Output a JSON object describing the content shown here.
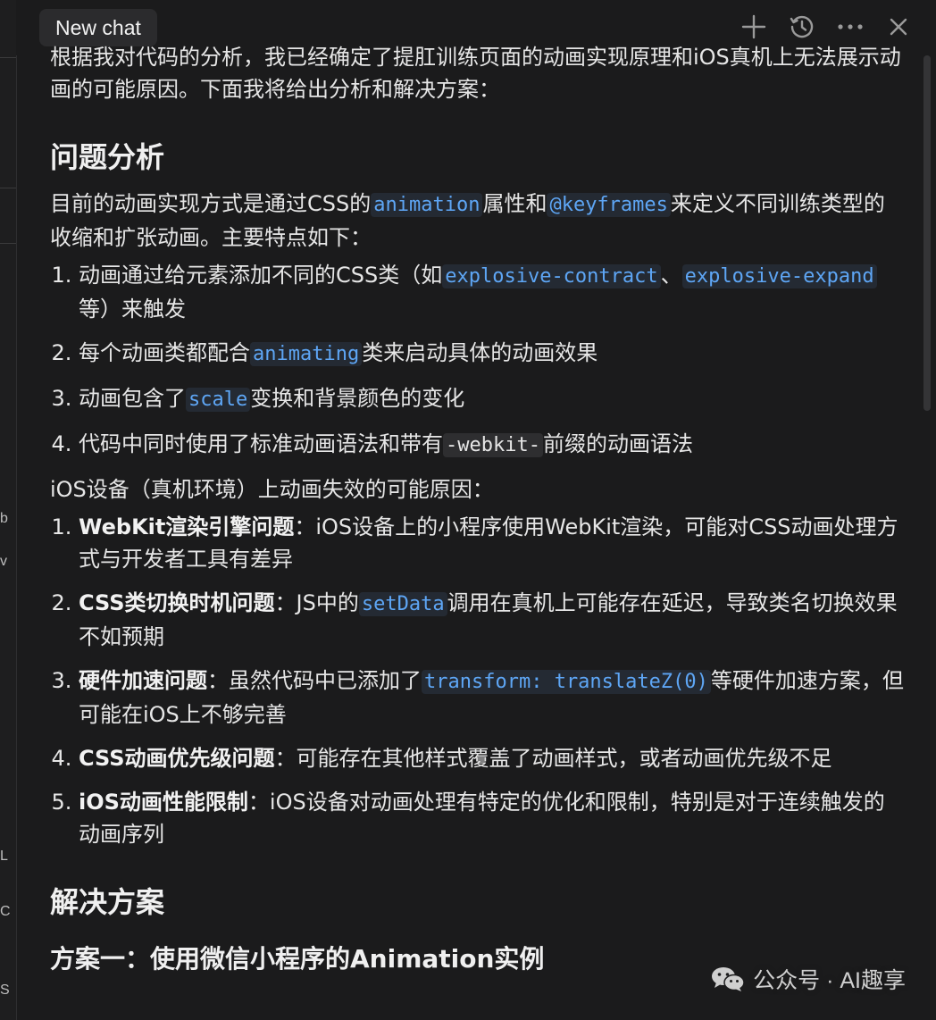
{
  "header": {
    "tab_title": "New chat",
    "icons": [
      "plus-icon",
      "history-icon",
      "more-icon",
      "close-icon"
    ]
  },
  "gutter": {
    "glyphs": [
      "b",
      "v",
      "L",
      "C",
      "S"
    ]
  },
  "message": {
    "intro": "根据我对代码的分析，我已经确定了提肛训练页面的动画实现原理和iOS真机上无法展示动画的可能原因。下面我将给出分析和解决方案：",
    "section1_title": "问题分析",
    "para1": {
      "t1": "目前的动画实现方式是通过CSS的",
      "c1": "animation",
      "t2": "属性和",
      "c2": "@keyframes",
      "t3": "来定义不同训练类型的收缩和扩张动画。主要特点如下："
    },
    "features": [
      {
        "t1": "动画通过给元素添加不同的CSS类（如",
        "c1": "explosive-contract",
        "t2": "、",
        "c2": "explosive-expand",
        "t3": "等）来触发"
      },
      {
        "t1": "每个动画类都配合",
        "c1": "animating",
        "t2": "类来启动具体的动画效果"
      },
      {
        "t1": "动画包含了",
        "c1": "scale",
        "t2": "变换和背景颜色的变化"
      },
      {
        "t1": "代码中同时使用了标准动画语法和带有",
        "c1": "-webkit-",
        "t2": "前缀的动画语法"
      }
    ],
    "para2": "iOS设备（真机环境）上动画失效的可能原因：",
    "causes": [
      {
        "b": "WebKit渲染引擎问题",
        "t1": "：iOS设备上的小程序使用WebKit渲染，可能对CSS动画处理方式与开发者工具有差异"
      },
      {
        "b": "CSS类切换时机问题",
        "t1": "：JS中的",
        "c1": "setData",
        "t2": "调用在真机上可能存在延迟，导致类名切换效果不如预期"
      },
      {
        "b": "硬件加速问题",
        "t1": "：虽然代码中已添加了",
        "c1": "transform: translateZ(0)",
        "t2": "等硬件加速方案，但可能在iOS上不够完善"
      },
      {
        "b": "CSS动画优先级问题",
        "t1": "：可能存在其他样式覆盖了动画样式，或者动画优先级不足"
      },
      {
        "b": "iOS动画性能限制",
        "t1": "：iOS设备对动画处理有特定的优化和限制，特别是对于连续触发的动画序列"
      }
    ],
    "section2_title": "解决方案",
    "subsection1_title": "方案一：使用微信小程序的Animation实例"
  },
  "watermark": {
    "text": "公众号 · AI趣享",
    "icon": "wechat-icon"
  },
  "colors": {
    "background": "#1b1b1c",
    "code_text": "#5ea6f5",
    "text": "#e6e6e6"
  }
}
